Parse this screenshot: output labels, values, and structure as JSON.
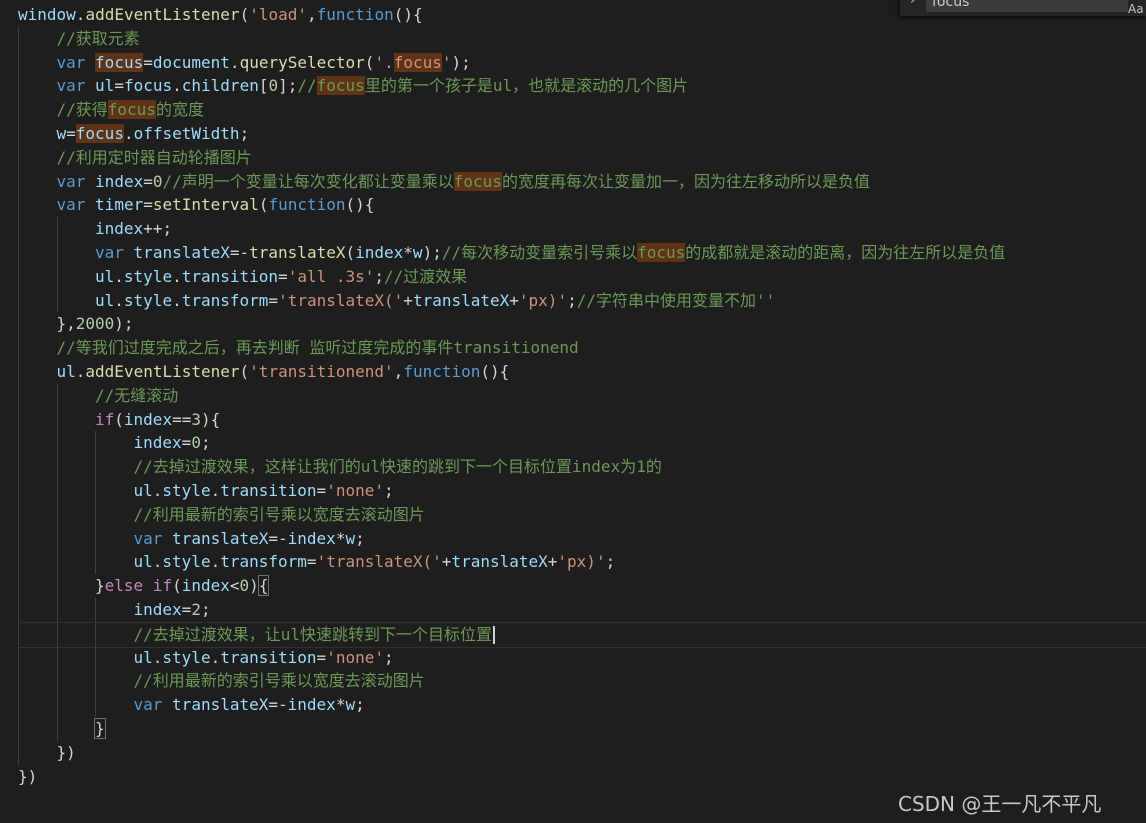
{
  "find_widget": {
    "query": "focus",
    "case_toggle": "Aa"
  },
  "watermark": "CSDN @王一凡不平凡",
  "code_lines": [
    {
      "indent": 0,
      "tokens": [
        [
          "var",
          "window"
        ],
        [
          "p",
          "."
        ],
        [
          "fn",
          "addEventListener"
        ],
        [
          "p",
          "("
        ],
        [
          "str",
          "'load'"
        ],
        [
          "p",
          ","
        ],
        [
          "kw",
          "function"
        ],
        [
          "p",
          "(){"
        ]
      ]
    },
    {
      "indent": 1,
      "tokens": [
        [
          "cmt",
          "//获取元素"
        ]
      ]
    },
    {
      "indent": 1,
      "tokens": [
        [
          "kw",
          "var"
        ],
        [
          "p",
          " "
        ],
        [
          "hlvar",
          "focus"
        ],
        [
          "p",
          "="
        ],
        [
          "var",
          "document"
        ],
        [
          "p",
          "."
        ],
        [
          "fn",
          "querySelector"
        ],
        [
          "p",
          "("
        ],
        [
          "str",
          "'."
        ],
        [
          "hlstr",
          "focus"
        ],
        [
          "str",
          "'"
        ],
        [
          "p",
          ");"
        ]
      ]
    },
    {
      "indent": 1,
      "tokens": [
        [
          "kw",
          "var"
        ],
        [
          "p",
          " "
        ],
        [
          "var",
          "ul"
        ],
        [
          "p",
          "="
        ],
        [
          "var",
          "focus"
        ],
        [
          "p",
          "."
        ],
        [
          "var",
          "children"
        ],
        [
          "p",
          "["
        ],
        [
          "num",
          "0"
        ],
        [
          "p",
          "];"
        ],
        [
          "cmt",
          "//"
        ],
        [
          "hlcmt",
          "focus"
        ],
        [
          "cmt",
          "里的第一个孩子是ul，也就是滚动的几个图片"
        ]
      ]
    },
    {
      "indent": 1,
      "tokens": [
        [
          "cmt",
          "//获得"
        ],
        [
          "hlcmt",
          "focus"
        ],
        [
          "cmt",
          "的宽度"
        ]
      ]
    },
    {
      "indent": 1,
      "tokens": [
        [
          "var",
          "w"
        ],
        [
          "p",
          "="
        ],
        [
          "hlvar",
          "focus"
        ],
        [
          "p",
          "."
        ],
        [
          "var",
          "offsetWidth"
        ],
        [
          "p",
          ";"
        ]
      ]
    },
    {
      "indent": 1,
      "tokens": [
        [
          "cmt",
          "//利用定时器自动轮播图片"
        ]
      ]
    },
    {
      "indent": 1,
      "tokens": [
        [
          "kw",
          "var"
        ],
        [
          "p",
          " "
        ],
        [
          "var",
          "index"
        ],
        [
          "p",
          "="
        ],
        [
          "num",
          "0"
        ],
        [
          "cmt",
          "//声明一个变量让每次变化都让变量乘以"
        ],
        [
          "hlcmt",
          "focus"
        ],
        [
          "cmt",
          "的宽度再每次让变量加一，因为往左移动所以是负值"
        ]
      ]
    },
    {
      "indent": 1,
      "tokens": [
        [
          "kw",
          "var"
        ],
        [
          "p",
          " "
        ],
        [
          "var",
          "timer"
        ],
        [
          "p",
          "="
        ],
        [
          "fn",
          "setInterval"
        ],
        [
          "p",
          "("
        ],
        [
          "kw",
          "function"
        ],
        [
          "p",
          "(){"
        ]
      ]
    },
    {
      "indent": 2,
      "tokens": [
        [
          "var",
          "index"
        ],
        [
          "p",
          "++;"
        ]
      ]
    },
    {
      "indent": 2,
      "tokens": [
        [
          "kw",
          "var"
        ],
        [
          "p",
          " "
        ],
        [
          "var",
          "translateX"
        ],
        [
          "p",
          "=-"
        ],
        [
          "fn",
          "translateX"
        ],
        [
          "p",
          "("
        ],
        [
          "var",
          "index"
        ],
        [
          "p",
          "*"
        ],
        [
          "var",
          "w"
        ],
        [
          "p",
          ");"
        ],
        [
          "cmt",
          "//每次移动变量索引号乘以"
        ],
        [
          "hlcmt",
          "focus"
        ],
        [
          "cmt",
          "的成都就是滚动的距离，因为往左所以是负值"
        ]
      ]
    },
    {
      "indent": 2,
      "tokens": [
        [
          "var",
          "ul"
        ],
        [
          "p",
          "."
        ],
        [
          "var",
          "style"
        ],
        [
          "p",
          "."
        ],
        [
          "var",
          "transition"
        ],
        [
          "p",
          "="
        ],
        [
          "str",
          "'all .3s'"
        ],
        [
          "p",
          ";"
        ],
        [
          "cmt",
          "//过渡效果"
        ]
      ]
    },
    {
      "indent": 2,
      "tokens": [
        [
          "var",
          "ul"
        ],
        [
          "p",
          "."
        ],
        [
          "var",
          "style"
        ],
        [
          "p",
          "."
        ],
        [
          "var",
          "transform"
        ],
        [
          "p",
          "="
        ],
        [
          "str",
          "'translateX('"
        ],
        [
          "p",
          "+"
        ],
        [
          "var",
          "translateX"
        ],
        [
          "p",
          "+"
        ],
        [
          "str",
          "'px)'"
        ],
        [
          "p",
          ";"
        ],
        [
          "cmt",
          "//字符串中使用变量不加''"
        ]
      ]
    },
    {
      "indent": 1,
      "tokens": [
        [
          "p",
          "},"
        ],
        [
          "num",
          "2000"
        ],
        [
          "p",
          ");"
        ]
      ]
    },
    {
      "indent": 1,
      "tokens": [
        [
          "cmt",
          "//等我们过度完成之后，再去判断 监听过度完成的事件transitionend"
        ]
      ]
    },
    {
      "indent": 1,
      "tokens": [
        [
          "var",
          "ul"
        ],
        [
          "p",
          "."
        ],
        [
          "fn",
          "addEventListener"
        ],
        [
          "p",
          "("
        ],
        [
          "str",
          "'transitionend'"
        ],
        [
          "p",
          ","
        ],
        [
          "kw",
          "function"
        ],
        [
          "p",
          "(){"
        ]
      ]
    },
    {
      "indent": 2,
      "tokens": [
        [
          "cmt",
          "//无缝滚动"
        ]
      ]
    },
    {
      "indent": 2,
      "tokens": [
        [
          "ctl",
          "if"
        ],
        [
          "p",
          "("
        ],
        [
          "var",
          "index"
        ],
        [
          "p",
          "=="
        ],
        [
          "num",
          "3"
        ],
        [
          "p",
          "){"
        ]
      ]
    },
    {
      "indent": 3,
      "tokens": [
        [
          "var",
          "index"
        ],
        [
          "p",
          "="
        ],
        [
          "num",
          "0"
        ],
        [
          "p",
          ";"
        ]
      ]
    },
    {
      "indent": 3,
      "tokens": [
        [
          "cmt",
          "//去掉过渡效果，这样让我们的ul快速的跳到下一个目标位置index为1的"
        ]
      ]
    },
    {
      "indent": 3,
      "tokens": [
        [
          "var",
          "ul"
        ],
        [
          "p",
          "."
        ],
        [
          "var",
          "style"
        ],
        [
          "p",
          "."
        ],
        [
          "var",
          "transition"
        ],
        [
          "p",
          "="
        ],
        [
          "str",
          "'none'"
        ],
        [
          "p",
          ";"
        ]
      ]
    },
    {
      "indent": 3,
      "tokens": [
        [
          "cmt",
          "//利用最新的索引号乘以宽度去滚动图片"
        ]
      ]
    },
    {
      "indent": 3,
      "tokens": [
        [
          "kw",
          "var"
        ],
        [
          "p",
          " "
        ],
        [
          "var",
          "translateX"
        ],
        [
          "p",
          "=-"
        ],
        [
          "var",
          "index"
        ],
        [
          "p",
          "*"
        ],
        [
          "var",
          "w"
        ],
        [
          "p",
          ";"
        ]
      ]
    },
    {
      "indent": 3,
      "tokens": [
        [
          "var",
          "ul"
        ],
        [
          "p",
          "."
        ],
        [
          "var",
          "style"
        ],
        [
          "p",
          "."
        ],
        [
          "var",
          "transform"
        ],
        [
          "p",
          "="
        ],
        [
          "str",
          "'translateX('"
        ],
        [
          "p",
          "+"
        ],
        [
          "var",
          "translateX"
        ],
        [
          "p",
          "+"
        ],
        [
          "str",
          "'px)'"
        ],
        [
          "p",
          ";"
        ]
      ]
    },
    {
      "indent": 2,
      "tokens": [
        [
          "p",
          "}"
        ],
        [
          "ctl",
          "else if"
        ],
        [
          "p",
          "("
        ],
        [
          "var",
          "index"
        ],
        [
          "p",
          "<"
        ],
        [
          "num",
          "0"
        ],
        [
          "p",
          ")"
        ],
        [
          "box",
          "{"
        ]
      ]
    },
    {
      "indent": 3,
      "tokens": [
        [
          "var",
          "index"
        ],
        [
          "p",
          "="
        ],
        [
          "num",
          "2"
        ],
        [
          "p",
          ";"
        ]
      ]
    },
    {
      "indent": 3,
      "current": true,
      "tokens": [
        [
          "cmt",
          "//去掉过渡效果，让ul快速跳转到下一个目标位置"
        ],
        [
          "cursor",
          ""
        ]
      ]
    },
    {
      "indent": 3,
      "tokens": [
        [
          "var",
          "ul"
        ],
        [
          "p",
          "."
        ],
        [
          "var",
          "style"
        ],
        [
          "p",
          "."
        ],
        [
          "var",
          "transition"
        ],
        [
          "p",
          "="
        ],
        [
          "str",
          "'none'"
        ],
        [
          "p",
          ";"
        ]
      ]
    },
    {
      "indent": 3,
      "tokens": [
        [
          "cmt",
          "//利用最新的索引号乘以宽度去滚动图片"
        ]
      ]
    },
    {
      "indent": 3,
      "tokens": [
        [
          "kw",
          "var"
        ],
        [
          "p",
          " "
        ],
        [
          "var",
          "translateX"
        ],
        [
          "p",
          "=-"
        ],
        [
          "var",
          "index"
        ],
        [
          "p",
          "*"
        ],
        [
          "var",
          "w"
        ],
        [
          "p",
          ";"
        ]
      ]
    },
    {
      "indent": 2,
      "tokens": [
        [
          "box",
          "}"
        ]
      ]
    },
    {
      "indent": 1,
      "tokens": [
        [
          "p",
          "})"
        ]
      ]
    },
    {
      "indent": 0,
      "tokens": [
        [
          "p",
          "})"
        ]
      ]
    }
  ]
}
